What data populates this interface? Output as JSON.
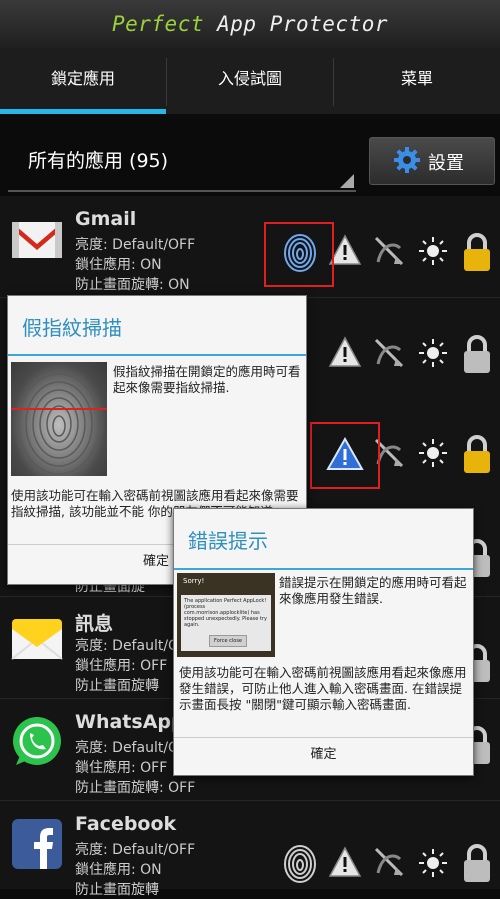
{
  "header": {
    "title_accent": "Perfect",
    "title_rest": " App Protector"
  },
  "tabs": [
    {
      "label": "鎖定應用"
    },
    {
      "label": "入侵試圖"
    },
    {
      "label": "菜單"
    }
  ],
  "filter": {
    "selected": "所有的應用 (95)",
    "settings_label": "設置"
  },
  "apps": [
    {
      "name": "Gmail",
      "brightness": "亮度: Default/OFF",
      "lock": "鎖住應用: ON",
      "rotate": "防止畫面旋轉: ON"
    },
    {
      "name": "訊息",
      "brightness": "亮度: Default/OFF",
      "lock": "鎖住應用: OFF",
      "rotate": "防止畫面旋轉"
    },
    {
      "name": "WhatsApp",
      "brightness": "亮度: Default/OFF",
      "lock": "鎖住應用: OFF",
      "rotate": "防止畫面旋轉: OFF"
    },
    {
      "name": "Facebook",
      "brightness": "亮度: Default/OFF",
      "lock": "鎖住應用: ON",
      "rotate": "防止畫面旋轉"
    }
  ],
  "dialog_fake_fp": {
    "title": "假指紋掃描",
    "desc": "假指紋掃描在開鎖定的應用時可看起來像需要指紋掃描.",
    "body": "使用該功能可在輸入密碼前視圖該應用看起來像需要指紋掃描, 該功能並不能 你的朋友們不可能知道.",
    "ok": "確定"
  },
  "dialog_error": {
    "title": "錯誤提示",
    "desc": "錯誤提示在開鎖定的應用時可看起來像應用發生錯誤.",
    "body": "使用該功能可在輸入密碼前視圖該應用看起來像應用發生錯誤，可防止他人進入輸入密碼畫面. 在錯誤提示畫面長按 \"關閉\"鍵可顯示輸入密碼畫面.",
    "ok": "確定",
    "shot_title": "Sorry!",
    "shot_text": "The application Perfect AppLock! (process com.morrison.applocklite) has stopped unexpectedly. Please try again.",
    "shot_button": "Force close"
  },
  "partial_rows": {
    "row2_rotate": "防止畫面旋"
  },
  "colors": {
    "accent": "#28b5e8",
    "title_green": "#9bd23a",
    "warning_blue": "#2f6fd6",
    "lock_gold": "#e8b30a"
  }
}
